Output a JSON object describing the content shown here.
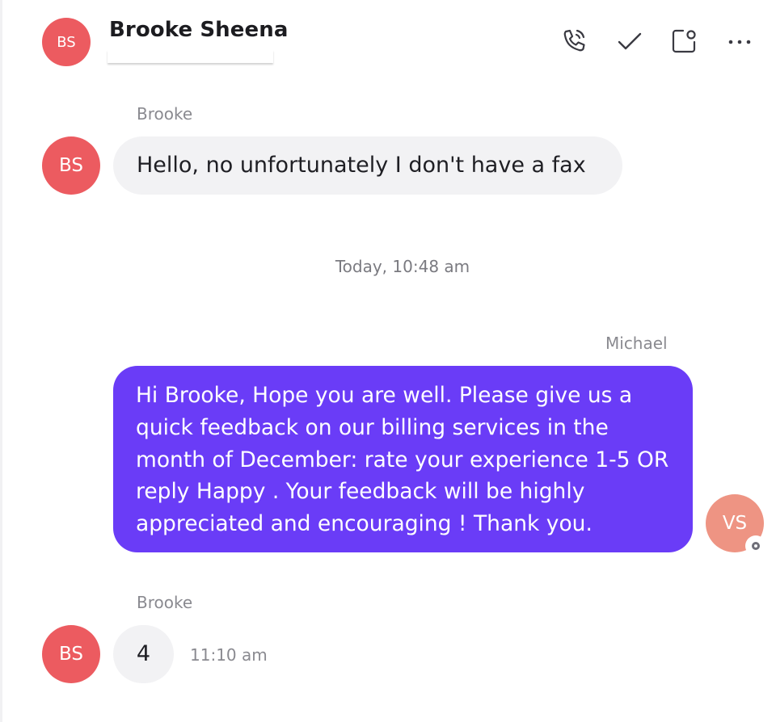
{
  "header": {
    "avatar_initials": "BS",
    "contact_name": "Brooke Sheena",
    "icons": [
      "phone-icon",
      "check-icon",
      "new-window-icon",
      "more-options-icon"
    ]
  },
  "messages": [
    {
      "sender": "Brooke",
      "avatar_initials": "BS",
      "text": "Hello, no unfortunately I don't have a fax"
    },
    {
      "separator": "Today, 10:48 am"
    },
    {
      "sender": "Michael",
      "avatar_initials": "VS",
      "text": "Hi Brooke, Hope you are well. Please give us a quick feedback on our billing services in the month of December: rate your experience 1-5 OR reply Happy . Your feedback will be highly appreciated and encouraging ! Thank you."
    },
    {
      "sender": "Brooke",
      "avatar_initials": "BS",
      "text": "4",
      "time": "11:10 am"
    }
  ],
  "colors": {
    "incoming_avatar": "#ec5b60",
    "outgoing_avatar": "#ee9483",
    "outgoing_bubble": "#6a3cf7",
    "incoming_bubble": "#f2f2f4"
  }
}
